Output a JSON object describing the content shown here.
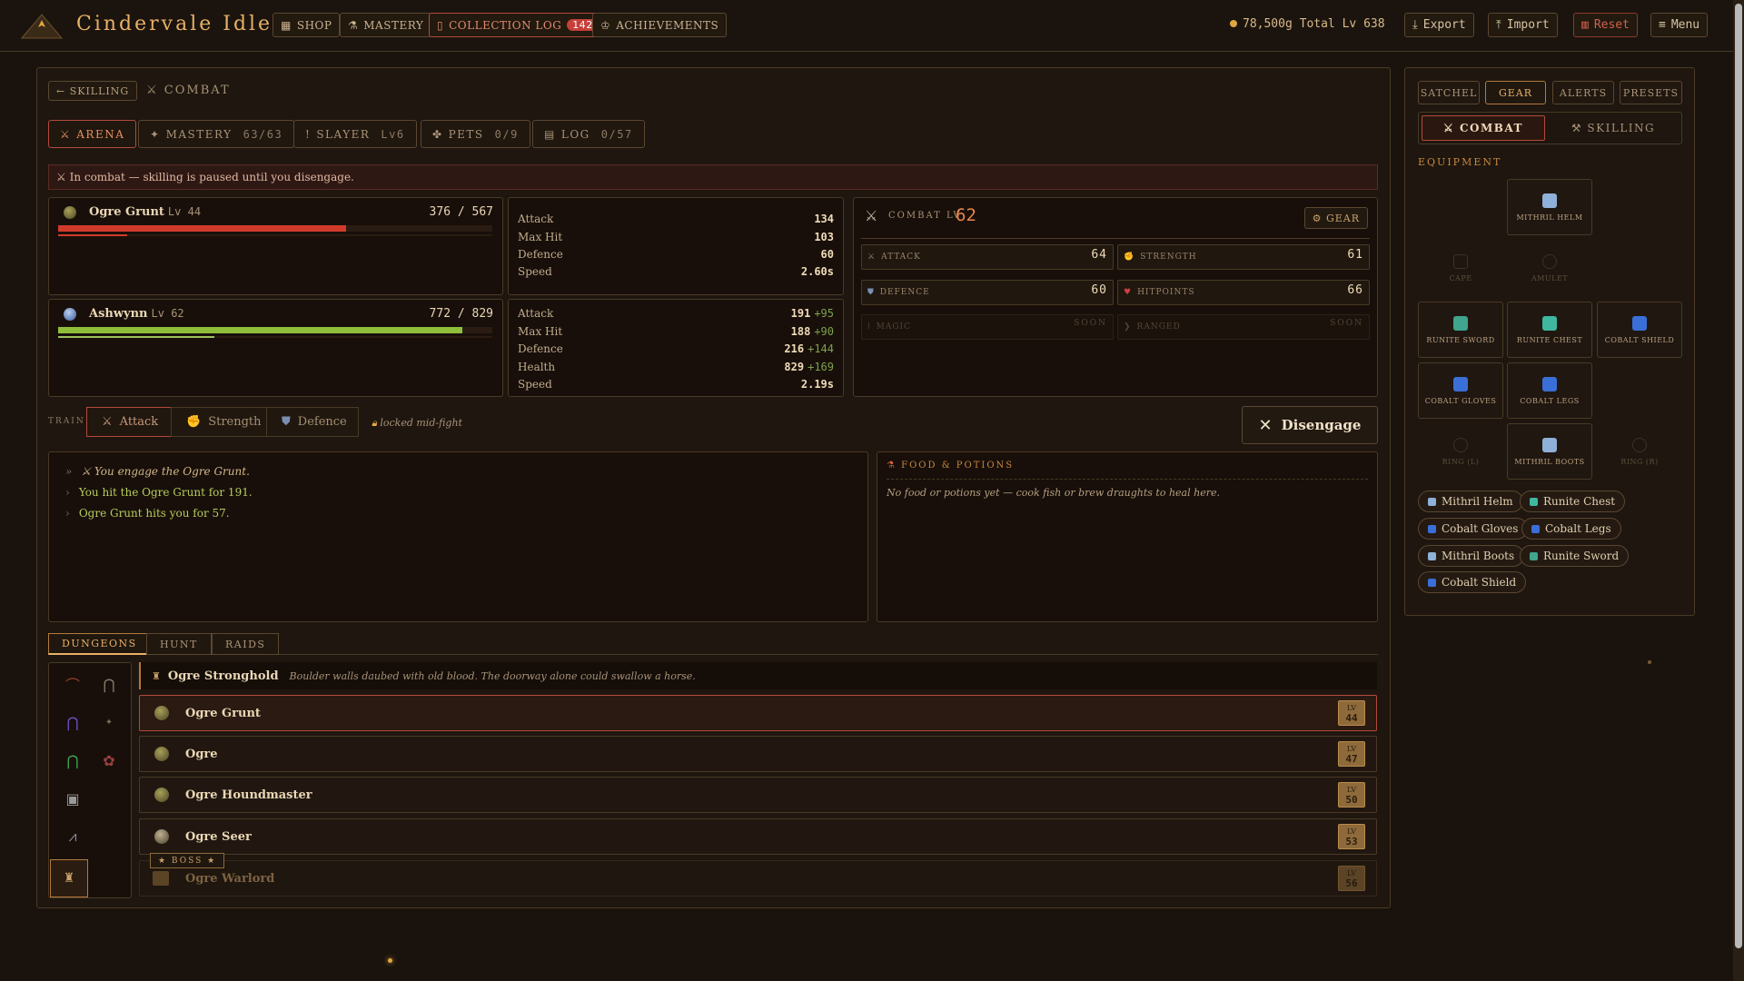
{
  "header": {
    "brand": "Cindervale Idle",
    "nav": [
      {
        "label": "SHOP",
        "icon": "shop-icon"
      },
      {
        "label": "MASTERY",
        "icon": "flask-icon"
      },
      {
        "label": "COLLECTION LOG",
        "icon": "book-icon",
        "badge": "142"
      },
      {
        "label": "ACHIEVEMENTS",
        "icon": "trophy-icon"
      }
    ],
    "gold": "78,500g",
    "total_lv": "Total Lv 638",
    "export": "Export",
    "import": "Import",
    "reset": "Reset",
    "menu": "Menu"
  },
  "main": {
    "back_label": "← SKILLING",
    "crumb": "COMBAT",
    "tabs": [
      {
        "label": "ARENA",
        "sub": ""
      },
      {
        "label": "MASTERY",
        "sub": "63/63"
      },
      {
        "label": "SLAYER",
        "sub": "Lv6"
      },
      {
        "label": "PETS",
        "sub": "0/9"
      },
      {
        "label": "LOG",
        "sub": "0/57"
      }
    ],
    "warning": "⚔ In combat — skilling is paused until you disengage.",
    "enemy": {
      "name": "Ogre Grunt",
      "level": "Lv 44",
      "hp": "376 / 567",
      "hp_fraction": 0.663,
      "attack_fraction": 0.16,
      "stats": [
        {
          "label": "Attack",
          "value": "134",
          "bonus": ""
        },
        {
          "label": "Max Hit",
          "value": "103",
          "bonus": ""
        },
        {
          "label": "Defence",
          "value": "60",
          "bonus": ""
        },
        {
          "label": "Speed",
          "value": "2.60s",
          "bonus": ""
        }
      ]
    },
    "player": {
      "name": "Ashwynn",
      "level": "Lv 62",
      "hp": "772 / 829",
      "hp_fraction": 0.931,
      "attack_fraction": 0.36,
      "stats": [
        {
          "label": "Attack",
          "value": "191",
          "bonus": "+95"
        },
        {
          "label": "Max Hit",
          "value": "188",
          "bonus": "+90"
        },
        {
          "label": "Defence",
          "value": "216",
          "bonus": "+144"
        },
        {
          "label": "Health",
          "value": "829",
          "bonus": "+169"
        },
        {
          "label": "Speed",
          "value": "2.19s",
          "bonus": ""
        }
      ]
    },
    "combat": {
      "label": "Combat Lv",
      "level": "62",
      "gear_button": "⚙ GEAR",
      "skills": [
        {
          "label": "Attack",
          "value": "64",
          "soon": ""
        },
        {
          "label": "Strength",
          "value": "61",
          "soon": ""
        },
        {
          "label": "Defence",
          "value": "60",
          "soon": ""
        },
        {
          "label": "Hitpoints",
          "value": "66",
          "soon": ""
        },
        {
          "label": "Magic",
          "value": "",
          "soon": "SOON"
        },
        {
          "label": "Ranged",
          "value": "",
          "soon": "SOON"
        }
      ]
    },
    "train": {
      "label": "Train",
      "options": [
        "Attack",
        "Strength",
        "Defence"
      ],
      "locked": "locked mid-fight",
      "disengage": "Disengage"
    },
    "log": [
      "⚔ You engage the Ogre Grunt.",
      "You hit the Ogre Grunt for 191.",
      "Ogre Grunt hits you for 57."
    ],
    "food": {
      "title": "Food & Potions",
      "empty": "No food or potions yet — cook fish or brew draughts to heal here."
    },
    "dungeon_tabs": [
      "DUNGEONS",
      "HUNT",
      "RAIDS"
    ],
    "dungeon": {
      "name": "Ogre Stronghold",
      "desc": "Boulder walls daubed with old blood. The doorway alone could swallow a horse.",
      "monsters": [
        {
          "name": "Ogre Grunt",
          "lv": "44"
        },
        {
          "name": "Ogre",
          "lv": "47"
        },
        {
          "name": "Ogre Houndmaster",
          "lv": "50"
        },
        {
          "name": "Ogre Seer",
          "lv": "53"
        },
        {
          "name": "Ogre Warlord",
          "lv": "56"
        }
      ],
      "boss_label": "★ BOSS ★",
      "lv_prefix": "LV"
    }
  },
  "right": {
    "tabs": [
      "SATCHEL",
      "GEAR",
      "ALERTS",
      "PRESETS"
    ],
    "subtabs": [
      "⚔ COMBAT",
      "⚒ SKILLING"
    ],
    "equipment_label": "EQUIPMENT",
    "slots": [
      {
        "label": "Mithril Helm",
        "color": "#8fb0d8"
      },
      {
        "label": "Cape",
        "color": ""
      },
      {
        "label": "Amulet",
        "color": ""
      },
      {
        "label": "Runite Sword",
        "color": "#3fa58c"
      },
      {
        "label": "Runite Chest",
        "color": "#3fb8a0"
      },
      {
        "label": "Cobalt Shield",
        "color": "#3a6fd8"
      },
      {
        "label": "Cobalt Gloves",
        "color": "#3a6fd8"
      },
      {
        "label": "Cobalt Legs",
        "color": "#3a6fd8"
      },
      {
        "label": "Ring (L)",
        "color": ""
      },
      {
        "label": "Mithril Boots",
        "color": "#8fb0d8"
      },
      {
        "label": "Ring (R)",
        "color": ""
      }
    ],
    "chips": [
      {
        "label": "Mithril Helm",
        "color": "#8fb0d8"
      },
      {
        "label": "Runite Chest",
        "color": "#3fb8a0"
      },
      {
        "label": "Cobalt Gloves",
        "color": "#3a6fd8"
      },
      {
        "label": "Cobalt Legs",
        "color": "#3a6fd8"
      },
      {
        "label": "Mithril Boots",
        "color": "#8fb0d8"
      },
      {
        "label": "Runite Sword",
        "color": "#3fa58c"
      },
      {
        "label": "Cobalt Shield",
        "color": "#3a6fd8"
      }
    ]
  }
}
